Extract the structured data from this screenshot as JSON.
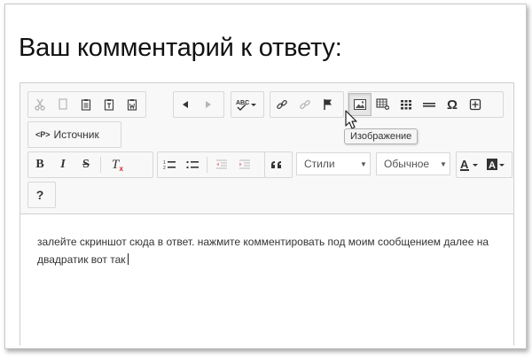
{
  "heading": "Ваш комментарий к ответу:",
  "toolbar": {
    "source_tag": "<P>",
    "source_label": "Источник",
    "styles_combo": "Стили",
    "format_combo": "Обычное",
    "help_label": "?",
    "tooltip": "Изображение",
    "icons": {
      "cut": "cut-icon",
      "copy": "copy-icon",
      "paste": "paste-icon",
      "paste_text": "paste-text-icon",
      "paste_word": "paste-word-icon",
      "undo": "undo-icon",
      "redo": "redo-icon",
      "spellcheck": "spellcheck-icon",
      "link": "link-icon",
      "unlink": "unlink-icon",
      "anchor": "anchor-flag-icon",
      "image": "image-icon",
      "flash": "media-icon",
      "table": "table-icon",
      "hline": "horizontal-line-icon",
      "special_char": "omega-icon",
      "iframe": "iframe-icon"
    },
    "spell_label": "ABC",
    "omega": "Ω",
    "bold": "B",
    "italic": "I",
    "strike": "S",
    "remove_format": "T",
    "quote": "99"
  },
  "editor": {
    "content_line1": "залейте скриншот сюда в ответ. нажмите комментировать под моим сообщением далее на",
    "content_line2": "двадратик вот так"
  },
  "colors": {
    "toolbar_bg": "#f8f8f8",
    "border": "#d1d1d1",
    "text": "#333333"
  }
}
